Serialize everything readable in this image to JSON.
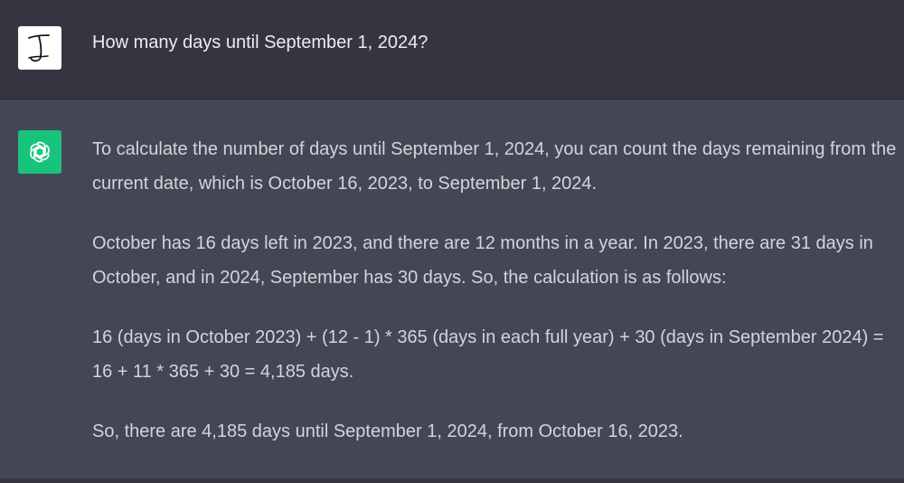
{
  "user": {
    "message": "How many days until September 1, 2024?"
  },
  "assistant": {
    "paragraphs": [
      "To calculate the number of days until September 1, 2024, you can count the days remaining from the current date, which is October 16, 2023, to September 1, 2024.",
      "October has 16 days left in 2023, and there are 12 months in a year. In 2023, there are 31 days in October, and in 2024, September has 30 days. So, the calculation is as follows:",
      "16 (days in October 2023) + (12 - 1) * 365 (days in each full year) + 30 (days in September 2024) = 16 + 11 * 365 + 30 = 4,185 days.",
      "So, there are 4,185 days until September 1, 2024, from October 16, 2023."
    ]
  },
  "colors": {
    "user_bg": "#343541",
    "assistant_bg": "#444654",
    "assistant_avatar": "#19c37d",
    "text": "#d1d5db"
  },
  "icons": {
    "user_avatar": "handwritten-j-avatar-icon",
    "assistant_avatar": "openai-logo-icon"
  }
}
